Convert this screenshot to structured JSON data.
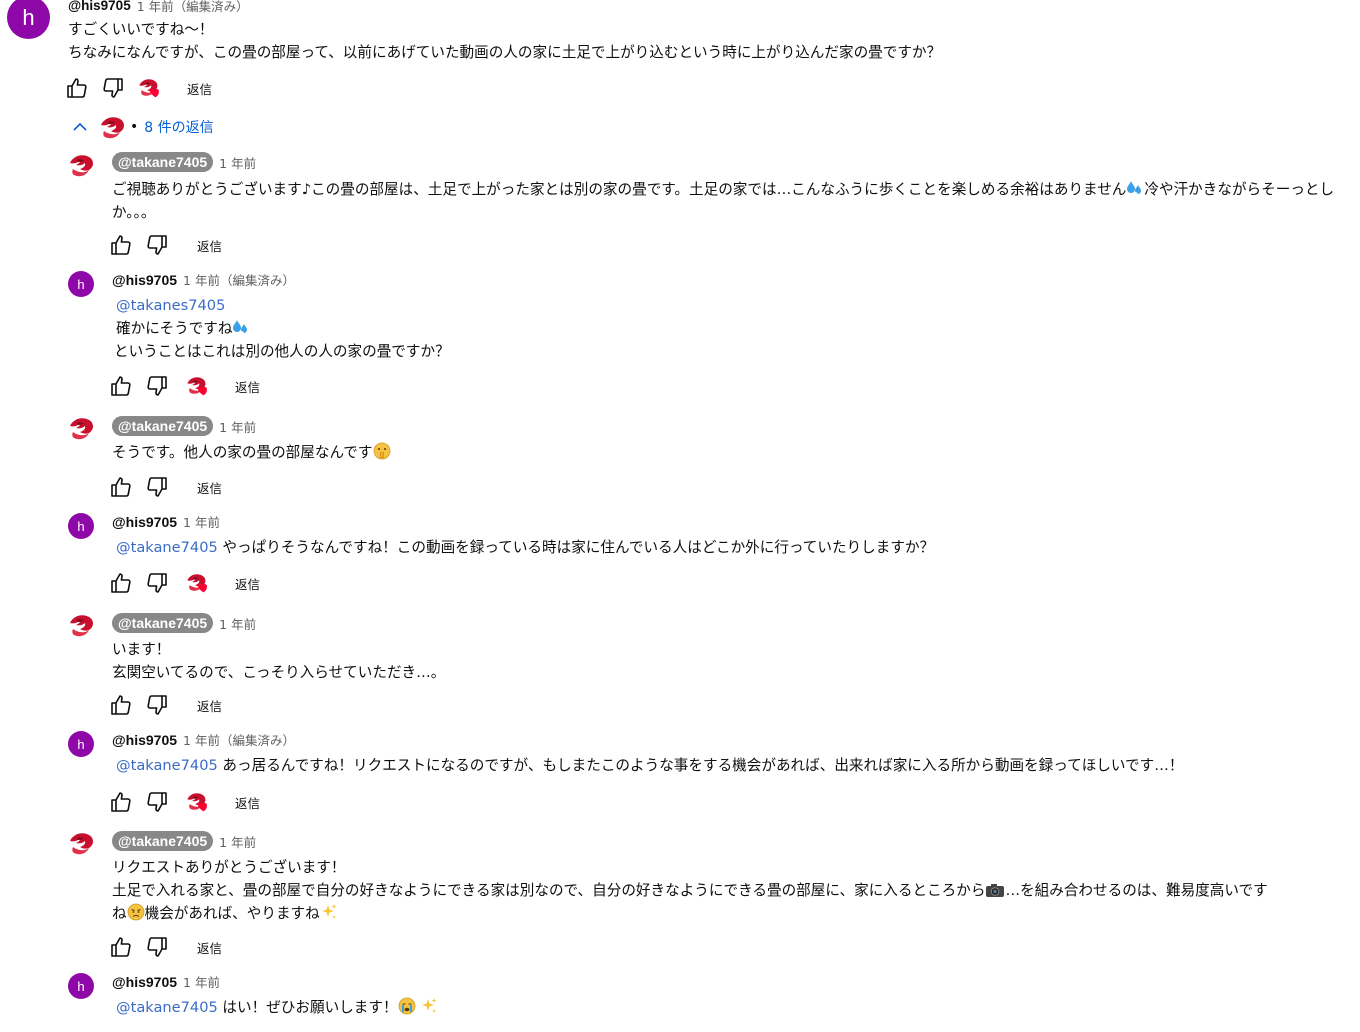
{
  "top": {
    "avatar_letter": "h",
    "author": "@his9705",
    "time": "1 年前",
    "edited": "（編集済み）",
    "line1": "すごくいいですね〜！",
    "line2": "ちなみになんですが、この畳の部屋って、以前にあげていた動画の人の家に土足で上がり込むという時に上がり込んだ家の畳ですか？",
    "reply_label": "返信"
  },
  "replies_toggle": {
    "bullet": "•",
    "label": "8 件の返信"
  },
  "replies": [
    {
      "author": "@takane7405",
      "time": "1 年前",
      "text": "ご視聴ありがとうございます♪この畳の部屋は、土足で上がった家とは別の家の畳です。土足の家では…こんなふうに歩くことを楽しめる余裕はありません",
      "text_after": "冷や汗かきながらそーっとしか。。。",
      "reply_label": "返信"
    },
    {
      "avatar_letter": "h",
      "author": "@his9705",
      "time": "1 年前",
      "edited": "（編集済み）",
      "mention": "@takanes7405",
      "line1": "確かにそうですね",
      "line2": "ということはこれは別の他人の人の家の畳ですか？",
      "reply_label": "返信"
    },
    {
      "author": "@takane7405",
      "time": "1 年前",
      "text": "そうです。他人の家の畳の部屋なんです",
      "reply_label": "返信"
    },
    {
      "avatar_letter": "h",
      "author": "@his9705",
      "time": "1 年前",
      "mention": "@takane7405",
      "text": "やっぱりそうなんですね！この動画を録っている時は家に住んでいる人はどこか外に行っていたりしますか？",
      "reply_label": "返信"
    },
    {
      "author": "@takane7405",
      "time": "1 年前",
      "line1": "います！",
      "line2": "玄関空いてるので、こっそり入らせていただき…。",
      "reply_label": "返信"
    },
    {
      "avatar_letter": "h",
      "author": "@his9705",
      "time": "1 年前",
      "edited": "（編集済み）",
      "mention": "@takane7405",
      "text": "あっ居るんですね！リクエストになるのですが、もしまたこのような事をする機会があれば、出来れば家に入る所から動画を録ってほしいです…！",
      "reply_label": "返信"
    },
    {
      "author": "@takane7405",
      "time": "1 年前",
      "line1": "リクエストありがとうございます！",
      "line2a": "土足で入れる家と、畳の部屋で自分の好きなようにできる家は別なので、自分の好きなようにできる畳の部屋に、家に入るところから",
      "line2b": "…を組み合わせるのは、難易度高いです",
      "line3a": "ね",
      "line3b": "機会があれば、やりますね",
      "reply_label": "返信"
    },
    {
      "avatar_letter": "h",
      "author": "@his9705",
      "time": "1 年前",
      "mention": "@takane7405",
      "text": "はい！ぜひお願いします！",
      "reply_label": "返信"
    }
  ],
  "colors": {
    "avatar_purple": "#8e08a8",
    "mention_blue": "#3a6cc7",
    "reply_toggle_blue": "#065fd4",
    "heart_red": "#ff0033",
    "badge_gray": "#888888"
  },
  "icons": [
    "thumbs-up-icon",
    "thumbs-down-icon",
    "creator-heart-icon",
    "chevron-up-icon",
    "sweat-emoji-icon",
    "shush-emoji-icon",
    "camera-emoji-icon",
    "worried-emoji-icon",
    "sparkles-emoji-icon",
    "crying-emoji-icon"
  ]
}
